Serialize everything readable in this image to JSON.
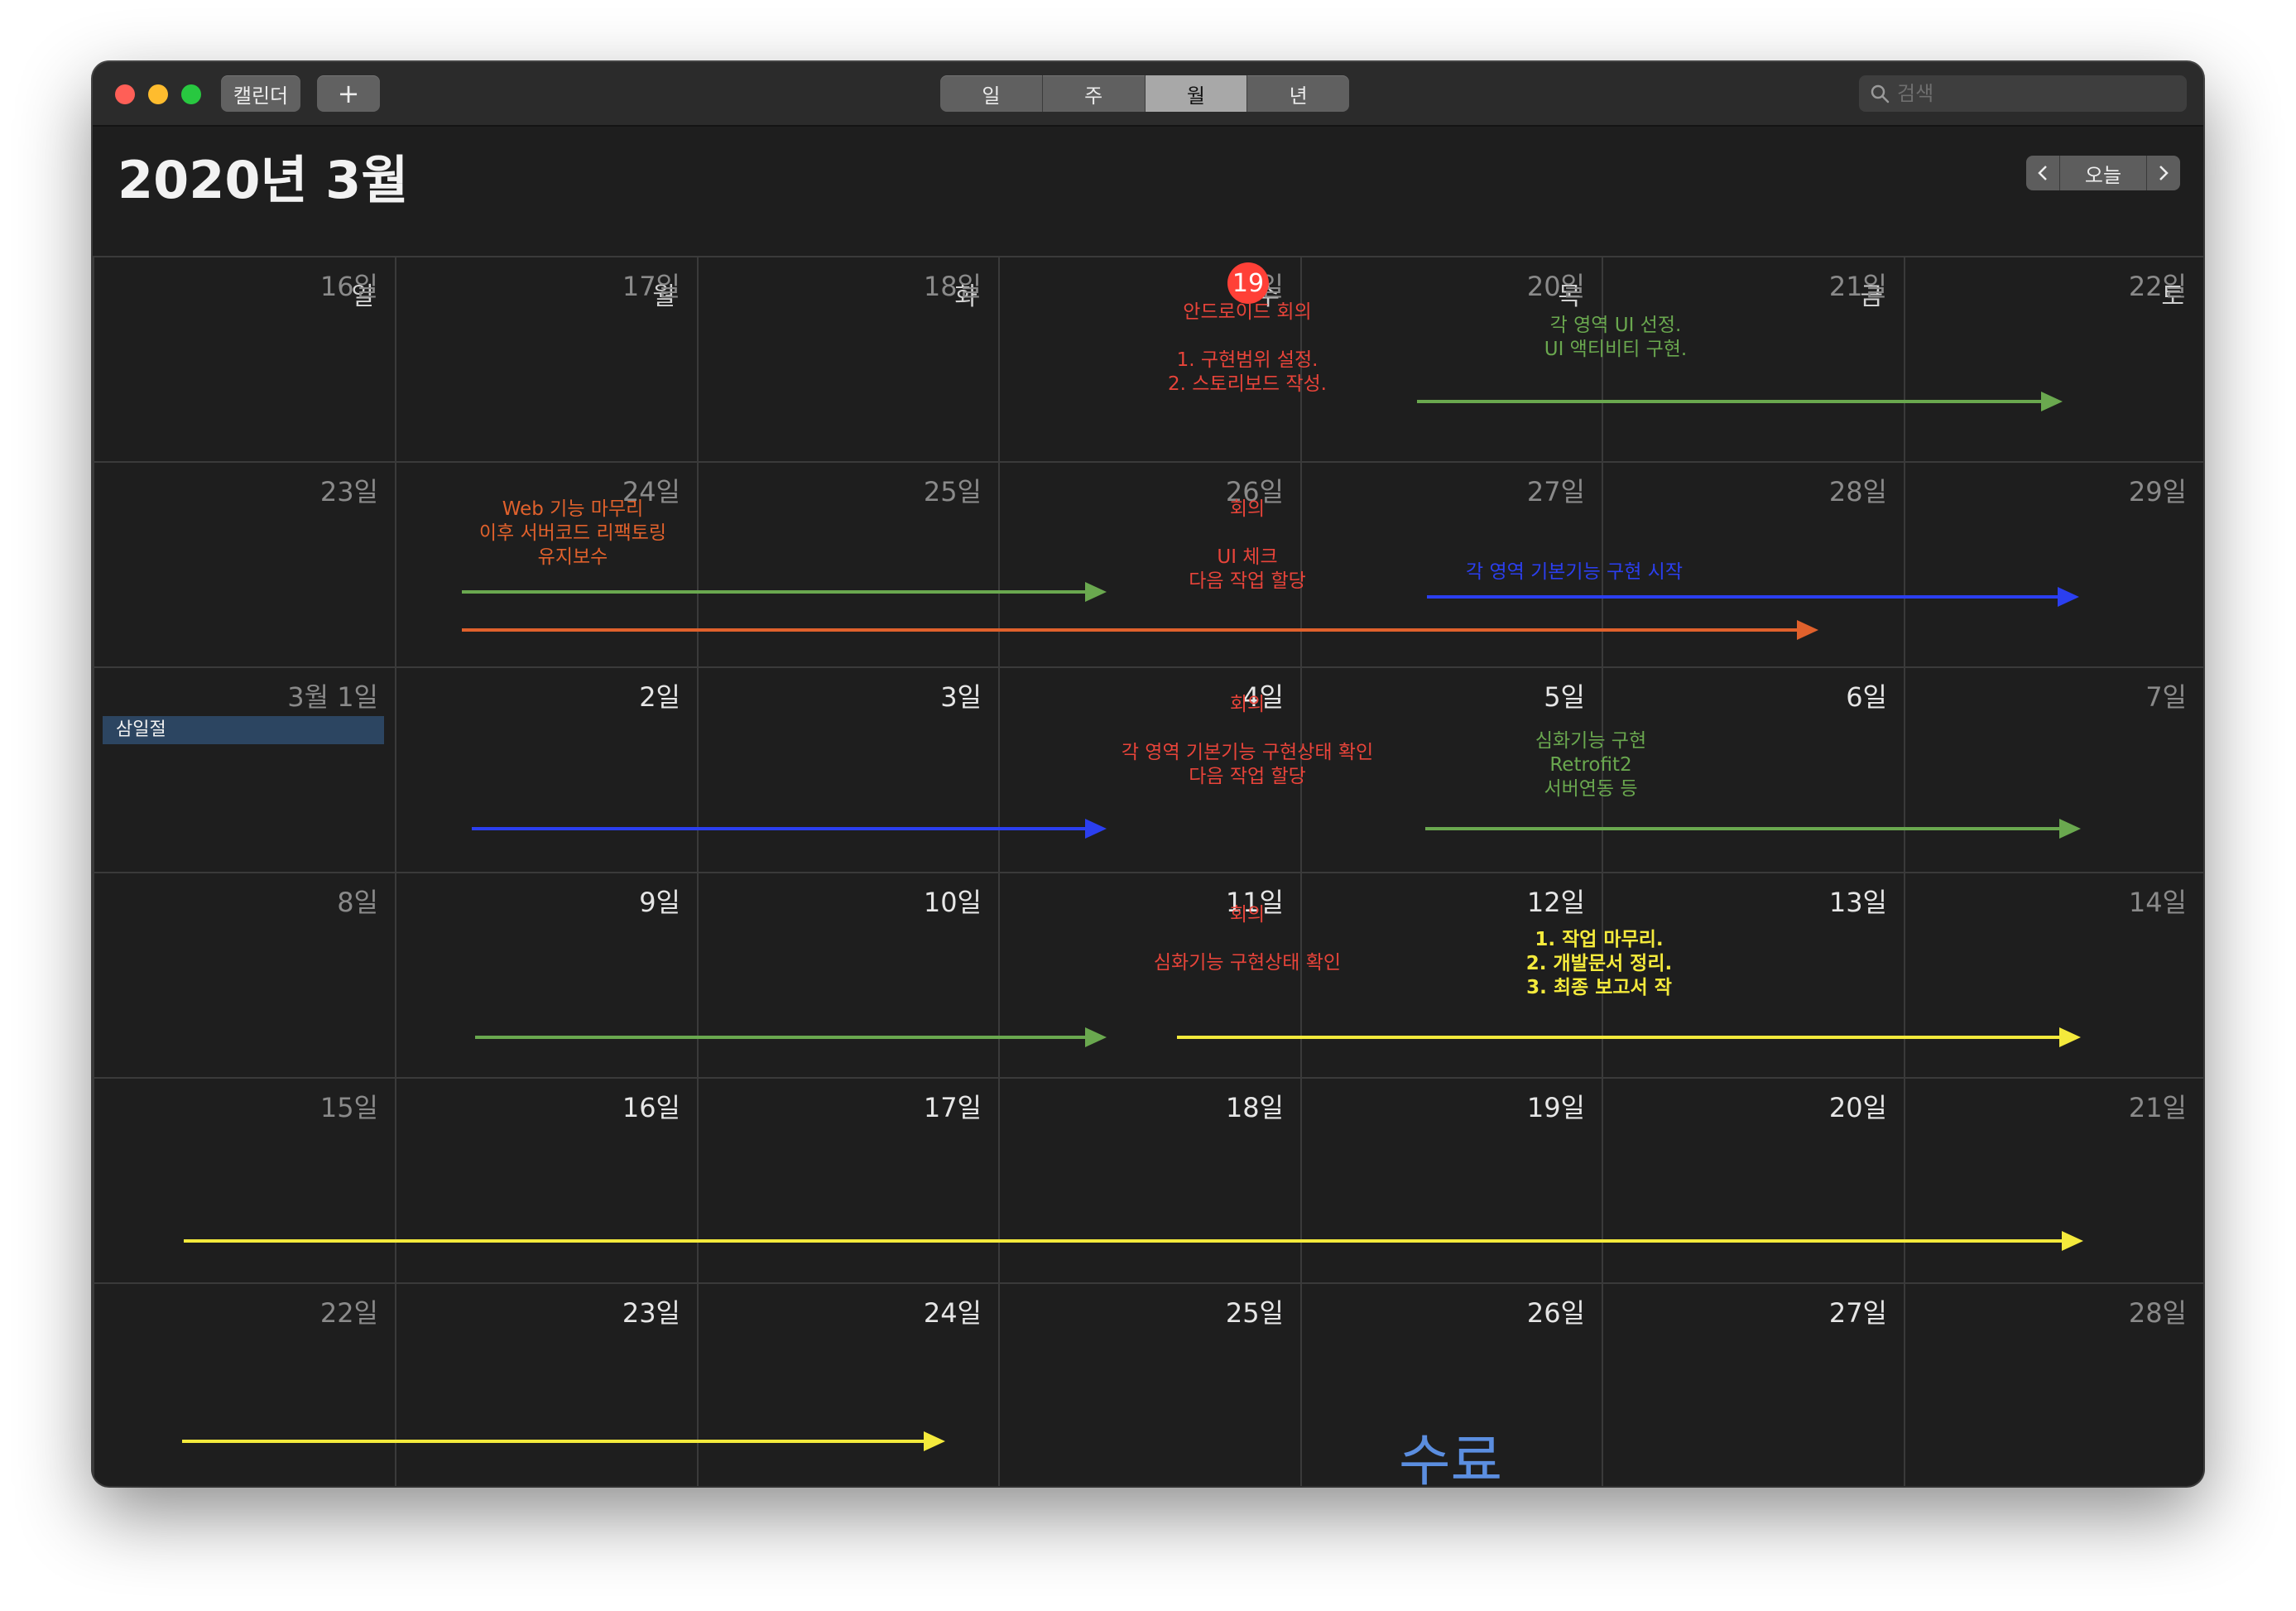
{
  "toolbar": {
    "calendars_label": "캘린더",
    "add_label": "+",
    "views": [
      {
        "label": "일",
        "active": false
      },
      {
        "label": "주",
        "active": false
      },
      {
        "label": "월",
        "active": true
      },
      {
        "label": "년",
        "active": false
      }
    ],
    "search_placeholder": "검색"
  },
  "header": {
    "title": "2020년 3월",
    "today_label": "오늘"
  },
  "weekdays": [
    "일",
    "월",
    "화",
    "수",
    "목",
    "금",
    "토"
  ],
  "weeks": [
    [
      "16일",
      "17일",
      "18일",
      "일",
      "20일",
      "21일",
      "22일"
    ],
    [
      "23일",
      "24일",
      "25일",
      "26일",
      "27일",
      "28일",
      "29일"
    ],
    [
      "3월 1일",
      "2일",
      "3일",
      "4일",
      "5일",
      "6일",
      "7일"
    ],
    [
      "8일",
      "9일",
      "10일",
      "11일",
      "12일",
      "13일",
      "14일"
    ],
    [
      "15일",
      "16일",
      "17일",
      "18일",
      "19일",
      "20일",
      "21일"
    ],
    [
      "22일",
      "23일",
      "24일",
      "25일",
      "26일",
      "27일",
      "28일"
    ]
  ],
  "dim_rows": [
    0,
    1
  ],
  "dim_cells": [
    [
      2,
      0
    ],
    [
      2,
      6
    ],
    [
      3,
      0
    ],
    [
      3,
      6
    ],
    [
      4,
      0
    ],
    [
      4,
      6
    ],
    [
      5,
      0
    ],
    [
      5,
      6
    ]
  ],
  "today_badge": "19",
  "holiday": "삼일절",
  "colors": {
    "red": "#e8443a",
    "orange": "#e0612c",
    "green": "#6aa84f",
    "blue": "#2b3ff0",
    "yellow": "#f4ea3c",
    "today": "#ff4037",
    "done": "#5b8ee0"
  },
  "notes": [
    {
      "text": "안드로이드 회의\n\n1. 구현범위 설정.\n2. 스토리보드 작성.",
      "color": "#e8443a"
    },
    {
      "text": "각 영역 UI 선정.\nUI 액티비티 구현.",
      "color": "#6aa84f"
    },
    {
      "text": "Web 기능 마무리\n이후 서버코드 리팩토링\n유지보수",
      "color": "#e0612c"
    },
    {
      "text": "회의\n\nUI 체크\n다음 작업 할당",
      "color": "#e8443a"
    },
    {
      "text": "각 영역 기본기능 구현 시작",
      "color": "#2b3ff0"
    },
    {
      "text": "회의\n\n각 영역 기본기능 구현상태 확인\n다음 작업 할당",
      "color": "#e8443a"
    },
    {
      "text": "심화기능 구현\nRetrofit2\n서버연동 등",
      "color": "#6aa84f"
    },
    {
      "text": "회의\n\n심화기능 구현상태 확인",
      "color": "#e8443a"
    },
    {
      "text": "1. 작업 마무리.\n2. 개발문서 정리.\n3. 최종 보고서 작",
      "color": "#f4ea3c"
    }
  ],
  "done_label": "수료"
}
